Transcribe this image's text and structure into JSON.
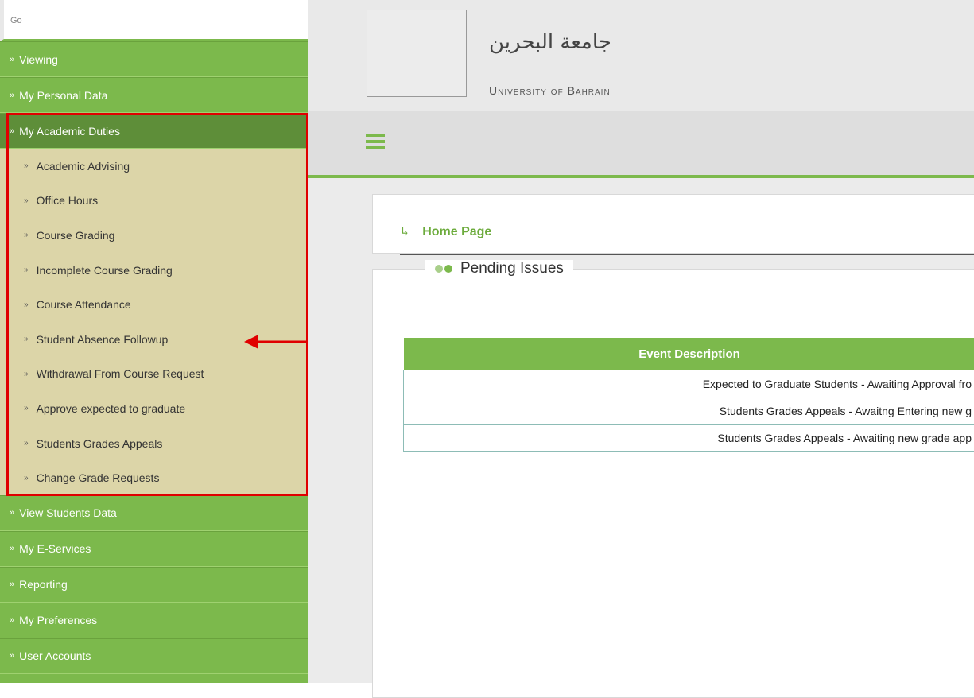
{
  "sidebar": {
    "go_label": "Go",
    "top_items": [
      {
        "label": "Viewing"
      },
      {
        "label": "My Personal Data"
      }
    ],
    "active_item": {
      "label": "My Academic Duties"
    },
    "sub_items": [
      {
        "label": "Academic Advising"
      },
      {
        "label": "Office Hours"
      },
      {
        "label": "Course Grading"
      },
      {
        "label": "Incomplete Course Grading"
      },
      {
        "label": "Course Attendance"
      },
      {
        "label": "Student Absence Followup"
      },
      {
        "label": "Withdrawal From Course Request"
      },
      {
        "label": "Approve expected to graduate"
      },
      {
        "label": "Students Grades Appeals"
      },
      {
        "label": "Change Grade Requests"
      }
    ],
    "bottom_items": [
      {
        "label": "View Students Data"
      },
      {
        "label": "My E-Services"
      },
      {
        "label": "Reporting"
      },
      {
        "label": "My Preferences"
      },
      {
        "label": "User Accounts"
      }
    ],
    "arrow_glyph": "»"
  },
  "header": {
    "university_arabic": "جامعة البحرين",
    "university_english": "University of Bahrain"
  },
  "breadcrumb": {
    "glyph": "↳",
    "label": "Home Page"
  },
  "pending": {
    "title": "Pending Issues",
    "table": {
      "header": "Event Description",
      "rows": [
        "Expected to Graduate Students - Awaiting Approval fro",
        "Students Grades Appeals - Awaitng Entering new g",
        "Students Grades Appeals - Awaiting new grade app"
      ]
    }
  },
  "colors": {
    "accent_green": "#7cb94c",
    "active_green": "#5e8e39",
    "submenu_bg": "#dcd5a8",
    "highlight_red": "#e00000"
  }
}
